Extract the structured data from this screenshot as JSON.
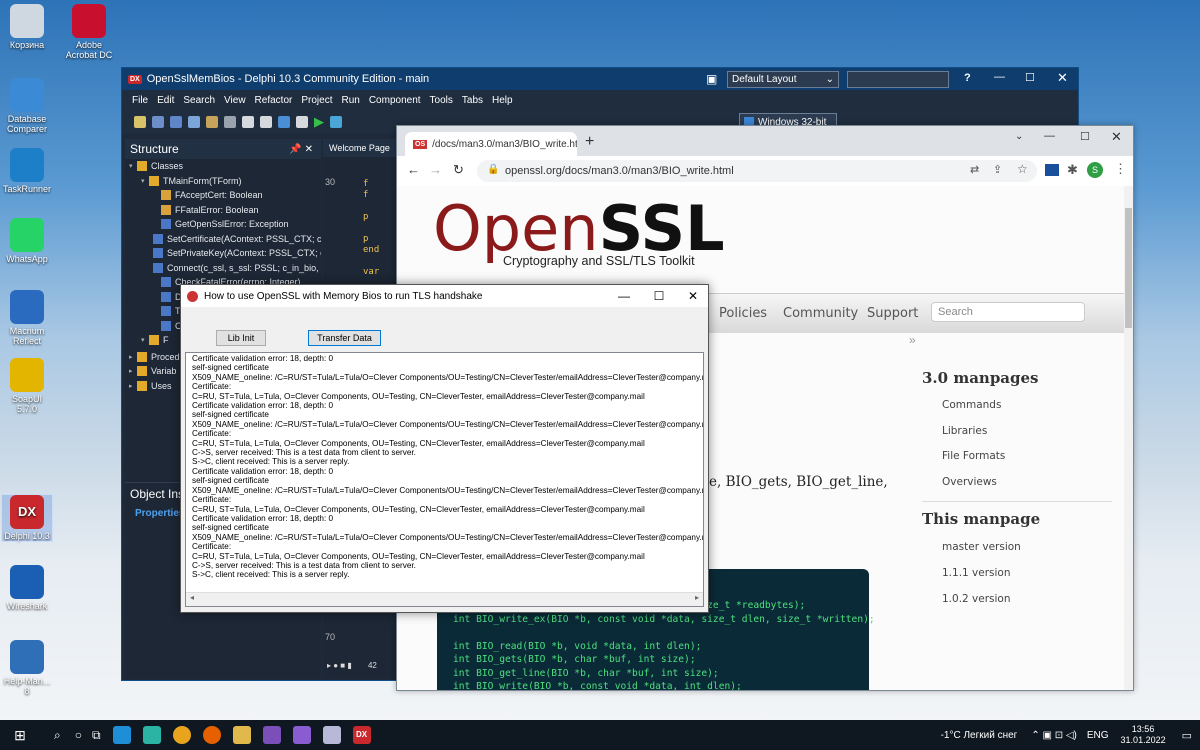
{
  "desktop": {
    "icons": [
      {
        "label": "Корзина",
        "icon": "recycle-bin-icon",
        "color": "#cfd8e0"
      },
      {
        "label": "Adobe Acrobat DC",
        "icon": "acrobat-icon",
        "color": "#c8102e"
      },
      {
        "label": "Database Comparer",
        "icon": "database-comparer-icon",
        "color": "#3a8ad6"
      },
      {
        "label": "TaskRunner",
        "icon": "taskrunner-icon",
        "color": "#1e7fc9"
      },
      {
        "label": "WhatsApp",
        "icon": "whatsapp-icon",
        "color": "#25d366"
      },
      {
        "label": "Macrium Reflect",
        "icon": "macrium-icon",
        "color": "#2a6bbf"
      },
      {
        "label": "SoapUI 5.7.0",
        "icon": "soapui-icon",
        "color": "#e3b400"
      },
      {
        "label": "Delphi 10.3",
        "icon": "delphi-icon",
        "color": "#c9282d"
      },
      {
        "label": "Wireshark",
        "icon": "wireshark-icon",
        "color": "#1a5fb4"
      },
      {
        "label": "Help-Man... 8",
        "icon": "helpman-icon",
        "color": "#2e6fb7"
      }
    ]
  },
  "delphi": {
    "title": "OpenSslMemBios - Delphi 10.3 Community Edition - main",
    "logo": "DX",
    "layout_combo": "Default Layout",
    "help": "?",
    "menu": [
      "File",
      "Edit",
      "Search",
      "View",
      "Refactor",
      "Project",
      "Run",
      "Component",
      "Tools",
      "Tabs",
      "Help"
    ],
    "platform": "Windows 32-bit",
    "structure_title": "Structure",
    "tree": [
      {
        "label": "Classes",
        "kind": "folder",
        "indent": 0
      },
      {
        "label": "TMainForm(TForm)",
        "kind": "folder",
        "indent": 1
      },
      {
        "label": "FAcceptCert: Boolean",
        "kind": "field",
        "indent": 2
      },
      {
        "label": "FFatalError: Boolean",
        "kind": "field",
        "indent": 2
      },
      {
        "label": "GetOpenSslError: Exception",
        "kind": "meth",
        "indent": 2
      },
      {
        "label": "SetCertificate(AContext: PSSL_CTX; cc",
        "kind": "meth",
        "indent": 2
      },
      {
        "label": "SetPrivateKey(AContext: PSSL_CTX; cc",
        "kind": "meth",
        "indent": 2
      },
      {
        "label": "Connect(c_ssl, s_ssl: PSSL; c_in_bio, c_",
        "kind": "meth",
        "indent": 2
      },
      {
        "label": "CheckFatalError(errno: Integer)",
        "kind": "meth",
        "indent": 2
      },
      {
        "label": "D",
        "kind": "meth",
        "indent": 2
      },
      {
        "label": "T",
        "kind": "meth",
        "indent": 2
      },
      {
        "label": "C",
        "kind": "meth",
        "indent": 2
      },
      {
        "label": "F",
        "kind": "folder",
        "indent": 1
      }
    ],
    "tree_bottom": [
      "Proced",
      "Variab",
      "Uses"
    ],
    "object_inspector": "Object Insp",
    "properties_tab": "Properties",
    "welcome_tab": "Welcome Page",
    "line_numbers": [
      "30",
      "70"
    ],
    "status_num": "42"
  },
  "chrome": {
    "tab_title": "/docs/man3.0/man3/BIO_write.ht",
    "url": "openssl.org/docs/man3.0/man3/BIO_write.html",
    "profile": "S",
    "logo_open": "Open",
    "logo_ssl": "SSL",
    "tagline": "Cryptography and SSL/TLS Toolkit",
    "nav": [
      "Policies",
      "Community",
      "Support"
    ],
    "search_placeholder": "Search",
    "chevron": "»",
    "partial_text": "e, BIO_gets, BIO_get_line,",
    "sidebar": {
      "h1": "3.0 manpages",
      "links1": [
        "Commands",
        "Libraries",
        "File Formats",
        "Overviews"
      ],
      "h2": "This manpage",
      "links2": [
        "master version",
        "1.1.1 version",
        "1.0.2 version"
      ]
    },
    "code_lines": [
      "                                       n, size_t *readbytes);",
      "int BIO_write_ex(BIO *b, const void *data, size_t dlen, size_t *written);",
      "",
      "int BIO_read(BIO *b, void *data, int dlen);",
      "int BIO_gets(BIO *b, char *buf, int size);",
      "int BIO_get_line(BIO *b, char *buf, int size);",
      "int BIO_write(BIO *b, const void *data, int dlen);"
    ]
  },
  "dialog": {
    "title": "How to use OpenSSL with Memory Bios to run TLS handshake",
    "lib_init": "Lib Init",
    "transfer": "Transfer Data",
    "log": "Certificate validation error: 18, depth: 0\nself-signed certificate\nX509_NAME_oneline: /C=RU/ST=Tula/L=Tula/O=Clever Components/OU=Testing/CN=CleverTester/emailAddress=CleverTester@company.mail\nCertificate:\nC=RU, ST=Tula, L=Tula, O=Clever Components, OU=Testing, CN=CleverTester, emailAddress=CleverTester@company.mail\nCertificate validation error: 18, depth: 0\nself-signed certificate\nX509_NAME_oneline: /C=RU/ST=Tula/L=Tula/O=Clever Components/OU=Testing/CN=CleverTester/emailAddress=CleverTester@company.mail\nCertificate:\nC=RU, ST=Tula, L=Tula, O=Clever Components, OU=Testing, CN=CleverTester, emailAddress=CleverTester@company.mail\nC->S, server received: This is a test data from client to server.\nS->C, client received: This is a server reply.\nCertificate validation error: 18, depth: 0\nself-signed certificate\nX509_NAME_oneline: /C=RU/ST=Tula/L=Tula/O=Clever Components/OU=Testing/CN=CleverTester/emailAddress=CleverTester@company.mail\nCertificate:\nC=RU, ST=Tula, L=Tula, O=Clever Components, OU=Testing, CN=CleverTester, emailAddress=CleverTester@company.mail\nCertificate validation error: 18, depth: 0\nself-signed certificate\nX509_NAME_oneline: /C=RU/ST=Tula/L=Tula/O=Clever Components/OU=Testing/CN=CleverTester/emailAddress=CleverTester@company.mail\nCertificate:\nC=RU, ST=Tula, L=Tula, O=Clever Components, OU=Testing, CN=CleverTester, emailAddress=CleverTester@company.mail\nC->S, server received: This is a test data from client to server.\nS->C, client received: This is a server reply."
  },
  "taskbar": {
    "weather": "-1°C  Легкий снег",
    "lang": "ENG",
    "time": "13:56",
    "date": "31.01.2022"
  }
}
